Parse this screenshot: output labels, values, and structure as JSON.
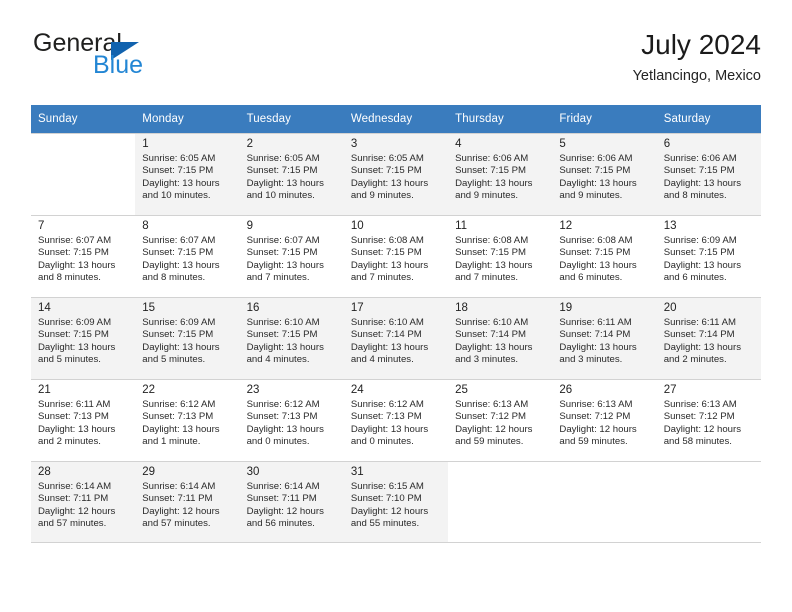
{
  "brand": {
    "name_top": "General",
    "name_bottom": "Blue",
    "triangle_color": "#1162ae",
    "blue_color": "#2386d4"
  },
  "header": {
    "title": "July 2024",
    "subtitle": "Yetlancingo, Mexico"
  },
  "theme": {
    "header_bg": "#3a7cbe",
    "header_text": "#ffffff",
    "row_shaded_bg": "#f3f3f3",
    "grid_line": "#d2d2d2"
  },
  "weekday_headers": [
    "Sunday",
    "Monday",
    "Tuesday",
    "Wednesday",
    "Thursday",
    "Friday",
    "Saturday"
  ],
  "labels": {
    "sunrise_prefix": "Sunrise:",
    "sunset_prefix": "Sunset:",
    "daylight_prefix": "Daylight:"
  },
  "weeks": [
    {
      "shaded": true,
      "days": [
        {
          "day": ""
        },
        {
          "day": "1",
          "sunrise": "Sunrise: 6:05 AM",
          "sunset": "Sunset: 7:15 PM",
          "daylight_line1": "Daylight: 13 hours",
          "daylight_line2": "and 10 minutes."
        },
        {
          "day": "2",
          "sunrise": "Sunrise: 6:05 AM",
          "sunset": "Sunset: 7:15 PM",
          "daylight_line1": "Daylight: 13 hours",
          "daylight_line2": "and 10 minutes."
        },
        {
          "day": "3",
          "sunrise": "Sunrise: 6:05 AM",
          "sunset": "Sunset: 7:15 PM",
          "daylight_line1": "Daylight: 13 hours",
          "daylight_line2": "and 9 minutes."
        },
        {
          "day": "4",
          "sunrise": "Sunrise: 6:06 AM",
          "sunset": "Sunset: 7:15 PM",
          "daylight_line1": "Daylight: 13 hours",
          "daylight_line2": "and 9 minutes."
        },
        {
          "day": "5",
          "sunrise": "Sunrise: 6:06 AM",
          "sunset": "Sunset: 7:15 PM",
          "daylight_line1": "Daylight: 13 hours",
          "daylight_line2": "and 9 minutes."
        },
        {
          "day": "6",
          "sunrise": "Sunrise: 6:06 AM",
          "sunset": "Sunset: 7:15 PM",
          "daylight_line1": "Daylight: 13 hours",
          "daylight_line2": "and 8 minutes."
        }
      ]
    },
    {
      "shaded": false,
      "days": [
        {
          "day": "7",
          "sunrise": "Sunrise: 6:07 AM",
          "sunset": "Sunset: 7:15 PM",
          "daylight_line1": "Daylight: 13 hours",
          "daylight_line2": "and 8 minutes."
        },
        {
          "day": "8",
          "sunrise": "Sunrise: 6:07 AM",
          "sunset": "Sunset: 7:15 PM",
          "daylight_line1": "Daylight: 13 hours",
          "daylight_line2": "and 8 minutes."
        },
        {
          "day": "9",
          "sunrise": "Sunrise: 6:07 AM",
          "sunset": "Sunset: 7:15 PM",
          "daylight_line1": "Daylight: 13 hours",
          "daylight_line2": "and 7 minutes."
        },
        {
          "day": "10",
          "sunrise": "Sunrise: 6:08 AM",
          "sunset": "Sunset: 7:15 PM",
          "daylight_line1": "Daylight: 13 hours",
          "daylight_line2": "and 7 minutes."
        },
        {
          "day": "11",
          "sunrise": "Sunrise: 6:08 AM",
          "sunset": "Sunset: 7:15 PM",
          "daylight_line1": "Daylight: 13 hours",
          "daylight_line2": "and 7 minutes."
        },
        {
          "day": "12",
          "sunrise": "Sunrise: 6:08 AM",
          "sunset": "Sunset: 7:15 PM",
          "daylight_line1": "Daylight: 13 hours",
          "daylight_line2": "and 6 minutes."
        },
        {
          "day": "13",
          "sunrise": "Sunrise: 6:09 AM",
          "sunset": "Sunset: 7:15 PM",
          "daylight_line1": "Daylight: 13 hours",
          "daylight_line2": "and 6 minutes."
        }
      ]
    },
    {
      "shaded": true,
      "days": [
        {
          "day": "14",
          "sunrise": "Sunrise: 6:09 AM",
          "sunset": "Sunset: 7:15 PM",
          "daylight_line1": "Daylight: 13 hours",
          "daylight_line2": "and 5 minutes."
        },
        {
          "day": "15",
          "sunrise": "Sunrise: 6:09 AM",
          "sunset": "Sunset: 7:15 PM",
          "daylight_line1": "Daylight: 13 hours",
          "daylight_line2": "and 5 minutes."
        },
        {
          "day": "16",
          "sunrise": "Sunrise: 6:10 AM",
          "sunset": "Sunset: 7:15 PM",
          "daylight_line1": "Daylight: 13 hours",
          "daylight_line2": "and 4 minutes."
        },
        {
          "day": "17",
          "sunrise": "Sunrise: 6:10 AM",
          "sunset": "Sunset: 7:14 PM",
          "daylight_line1": "Daylight: 13 hours",
          "daylight_line2": "and 4 minutes."
        },
        {
          "day": "18",
          "sunrise": "Sunrise: 6:10 AM",
          "sunset": "Sunset: 7:14 PM",
          "daylight_line1": "Daylight: 13 hours",
          "daylight_line2": "and 3 minutes."
        },
        {
          "day": "19",
          "sunrise": "Sunrise: 6:11 AM",
          "sunset": "Sunset: 7:14 PM",
          "daylight_line1": "Daylight: 13 hours",
          "daylight_line2": "and 3 minutes."
        },
        {
          "day": "20",
          "sunrise": "Sunrise: 6:11 AM",
          "sunset": "Sunset: 7:14 PM",
          "daylight_line1": "Daylight: 13 hours",
          "daylight_line2": "and 2 minutes."
        }
      ]
    },
    {
      "shaded": false,
      "days": [
        {
          "day": "21",
          "sunrise": "Sunrise: 6:11 AM",
          "sunset": "Sunset: 7:13 PM",
          "daylight_line1": "Daylight: 13 hours",
          "daylight_line2": "and 2 minutes."
        },
        {
          "day": "22",
          "sunrise": "Sunrise: 6:12 AM",
          "sunset": "Sunset: 7:13 PM",
          "daylight_line1": "Daylight: 13 hours",
          "daylight_line2": "and 1 minute."
        },
        {
          "day": "23",
          "sunrise": "Sunrise: 6:12 AM",
          "sunset": "Sunset: 7:13 PM",
          "daylight_line1": "Daylight: 13 hours",
          "daylight_line2": "and 0 minutes."
        },
        {
          "day": "24",
          "sunrise": "Sunrise: 6:12 AM",
          "sunset": "Sunset: 7:13 PM",
          "daylight_line1": "Daylight: 13 hours",
          "daylight_line2": "and 0 minutes."
        },
        {
          "day": "25",
          "sunrise": "Sunrise: 6:13 AM",
          "sunset": "Sunset: 7:12 PM",
          "daylight_line1": "Daylight: 12 hours",
          "daylight_line2": "and 59 minutes."
        },
        {
          "day": "26",
          "sunrise": "Sunrise: 6:13 AM",
          "sunset": "Sunset: 7:12 PM",
          "daylight_line1": "Daylight: 12 hours",
          "daylight_line2": "and 59 minutes."
        },
        {
          "day": "27",
          "sunrise": "Sunrise: 6:13 AM",
          "sunset": "Sunset: 7:12 PM",
          "daylight_line1": "Daylight: 12 hours",
          "daylight_line2": "and 58 minutes."
        }
      ]
    },
    {
      "shaded": true,
      "days": [
        {
          "day": "28",
          "sunrise": "Sunrise: 6:14 AM",
          "sunset": "Sunset: 7:11 PM",
          "daylight_line1": "Daylight: 12 hours",
          "daylight_line2": "and 57 minutes."
        },
        {
          "day": "29",
          "sunrise": "Sunrise: 6:14 AM",
          "sunset": "Sunset: 7:11 PM",
          "daylight_line1": "Daylight: 12 hours",
          "daylight_line2": "and 57 minutes."
        },
        {
          "day": "30",
          "sunrise": "Sunrise: 6:14 AM",
          "sunset": "Sunset: 7:11 PM",
          "daylight_line1": "Daylight: 12 hours",
          "daylight_line2": "and 56 minutes."
        },
        {
          "day": "31",
          "sunrise": "Sunrise: 6:15 AM",
          "sunset": "Sunset: 7:10 PM",
          "daylight_line1": "Daylight: 12 hours",
          "daylight_line2": "and 55 minutes."
        },
        {
          "day": ""
        },
        {
          "day": ""
        },
        {
          "day": ""
        }
      ]
    }
  ]
}
